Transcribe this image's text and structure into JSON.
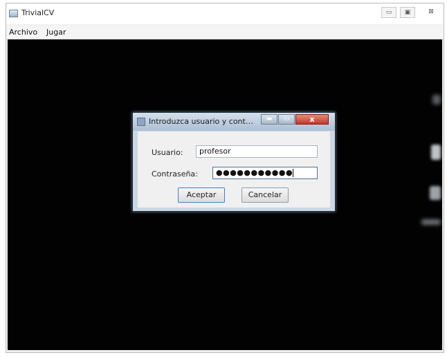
{
  "window": {
    "title": "TrivialCV",
    "controls": {
      "minimize": "▭",
      "maximize": "▣",
      "close": "⊠"
    },
    "menu": [
      "Archivo",
      "Jugar"
    ]
  },
  "dialog": {
    "title": "Introduzca usuario y contras...",
    "controls": {
      "minimize": "▬",
      "maximize": "▭",
      "close": "x"
    },
    "usuario_label": "Usuario:",
    "usuario_value": "profesor",
    "password_label": "Contraseña:",
    "password_value": "●●●●●●●●●●●",
    "accept_label": "Aceptar",
    "cancel_label": "Cancelar"
  },
  "colors": {
    "canvas": "#020202",
    "dialog_frame": "#cbd7e4",
    "close_button": "#c03a2a"
  }
}
